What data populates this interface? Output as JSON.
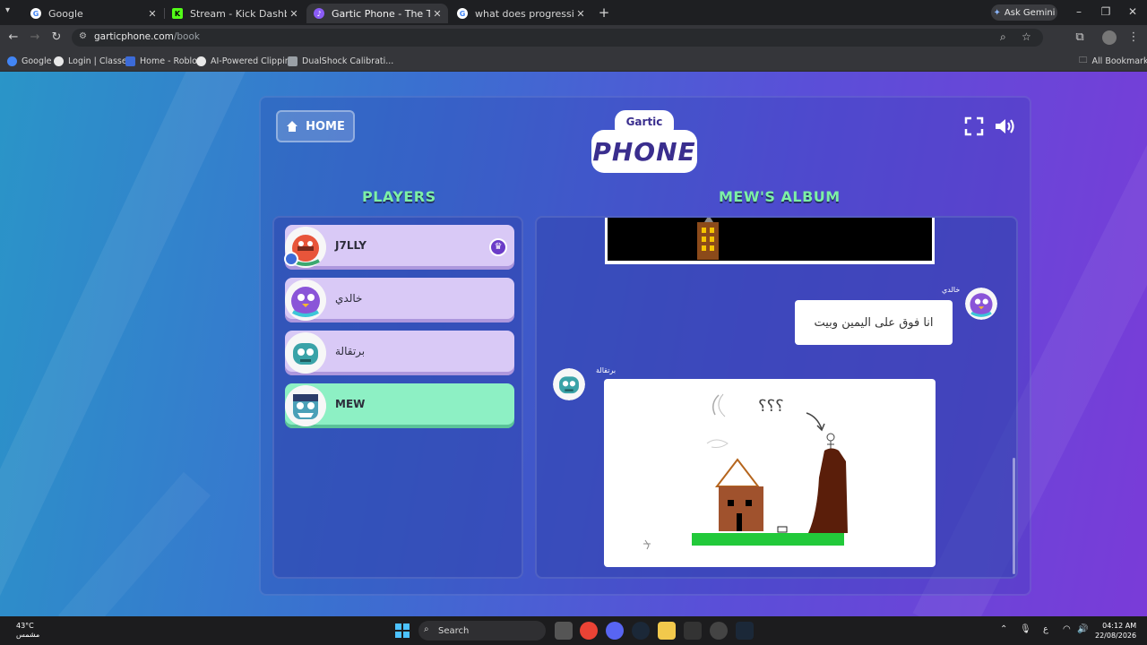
{
  "browser": {
    "tabs": [
      {
        "title": "Google",
        "icon_color": "#4285f4",
        "active": false
      },
      {
        "title": "Stream - Kick Dashboard",
        "icon_color": "#53fc18",
        "active": false
      },
      {
        "title": "Gartic Phone - The Telephone G",
        "icon_color": "#8b5cf6",
        "active": true
      },
      {
        "title": "what does progressive mean - G",
        "icon_color": "#4285f4",
        "active": false
      }
    ],
    "ask_gemini": "Ask Gemini",
    "url_host": "garticphone.com",
    "url_path": "/book",
    "bookmarks": [
      {
        "label": "Google",
        "color": "#4285f4"
      },
      {
        "label": "Login | Classera",
        "color": "#e8e8e8"
      },
      {
        "label": "Home - Roblox",
        "color": "#3c6bd8"
      },
      {
        "label": "AI-Powered Clippin...",
        "color": "#e8e8e8"
      },
      {
        "label": "DualShock Calibrati...",
        "color": "#9aa0a6"
      }
    ],
    "all_bookmarks": "All Bookmarks"
  },
  "game": {
    "home_label": "HOME",
    "logo_top": "Gartic",
    "logo_bottom": "PHONE",
    "players_title": "PLAYERS",
    "album_title": "MEW'S ALBUM",
    "players": [
      {
        "name": "J7LLY",
        "owner": true
      },
      {
        "name": "خالدي",
        "owner": false
      },
      {
        "name": "برتقالة",
        "owner": false
      },
      {
        "name": "MEW",
        "owner": false,
        "self": true
      }
    ],
    "album": {
      "guess_author": "خالدي",
      "guess_text": "انا فوق على اليمين وبيت",
      "drawing_author": "برتقالة",
      "drawing_scribble": "؟؟؟"
    }
  },
  "taskbar": {
    "temp": "43°C",
    "weather": "مشمس",
    "search_label": "Search",
    "lang": "ع",
    "time": "04:12 AM",
    "date": "22/08/2026"
  }
}
